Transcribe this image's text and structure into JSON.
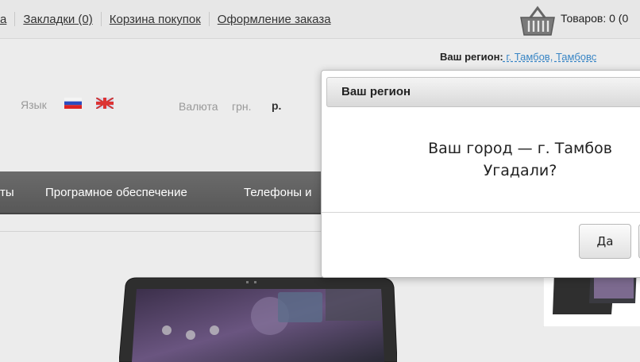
{
  "topbar": {
    "links": [
      "а",
      "Закладки (0)",
      "Корзина покупок",
      "Оформление заказа"
    ],
    "cart_text": "Товаров: 0 (0"
  },
  "region": {
    "label": "Ваш регион:",
    "value": " г. Тамбов, Тамбовс"
  },
  "language": {
    "label": "Язык"
  },
  "currency": {
    "label": "Валюта",
    "options": [
      "грн.",
      "р."
    ]
  },
  "nav": {
    "items": [
      "ты",
      "Програмное обеспечение",
      "Телефоны и"
    ]
  },
  "modal": {
    "title": "Ваш регион",
    "line1": "Ваш город — г. Тамбов",
    "line2": "Угадали?",
    "yes_label": "Да"
  },
  "colors": {
    "nav_bg": "#606060",
    "link_blue": "#3a86c5"
  }
}
